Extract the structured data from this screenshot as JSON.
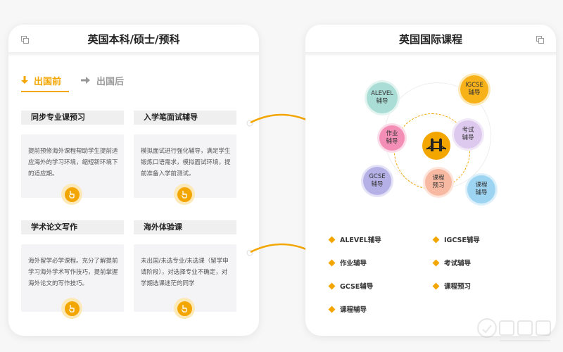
{
  "left_panel": {
    "title": "英国本科/硕士/预科",
    "tabs": [
      {
        "label": "出国前",
        "active": true
      },
      {
        "label": "出国后",
        "active": false
      }
    ],
    "cards": [
      {
        "title": "同步专业课预习",
        "text": "提前预修海外课程帮助学生提前适应海外的学习环境，缩短新环境下的适应期。"
      },
      {
        "title": "入学笔面试辅导",
        "text": "模拟面试进行强化辅导，满足学生锻炼口语需求，模拟面试环境，提前准备入学前测试。"
      },
      {
        "title": "学术论文写作",
        "text": "海外留学必学课程。充分了解提前学习海外学术写作技巧，提前掌握海外论文的写作技巧。"
      },
      {
        "title": "海外体验课",
        "text": "未出国/未选专业/未选课（留学申请阶段），对选择专业不确定，对学期选课迷茫的同学"
      }
    ]
  },
  "right_panel": {
    "title": "英国国际课程",
    "bubbles": [
      {
        "line1": "ALEVEL",
        "line2": "辅导",
        "color": "#a9ddd5"
      },
      {
        "line1": "IGCSE",
        "line2": "辅导",
        "color": "#f7b21a"
      },
      {
        "line1": "作业",
        "line2": "辅导",
        "color": "#f38fb6"
      },
      {
        "line1": "考试",
        "line2": "辅导",
        "color": "#ddc8ee"
      },
      {
        "line1": "GCSE",
        "line2": "辅导",
        "color": "#b5b1e6"
      },
      {
        "line1": "课程",
        "line2": "预习",
        "color": "#f7b9a2"
      },
      {
        "line1": "课程",
        "line2": "辅导",
        "color": "#9cd4f2"
      }
    ],
    "legend": [
      "ALEVEL辅导",
      "IGCSE辅导",
      "作业辅导",
      "考试辅导",
      "GCSE辅导",
      "课程预习",
      "课程辅导"
    ]
  },
  "colors": {
    "accent": "#f3a500",
    "tab_inactive": "#999999"
  }
}
